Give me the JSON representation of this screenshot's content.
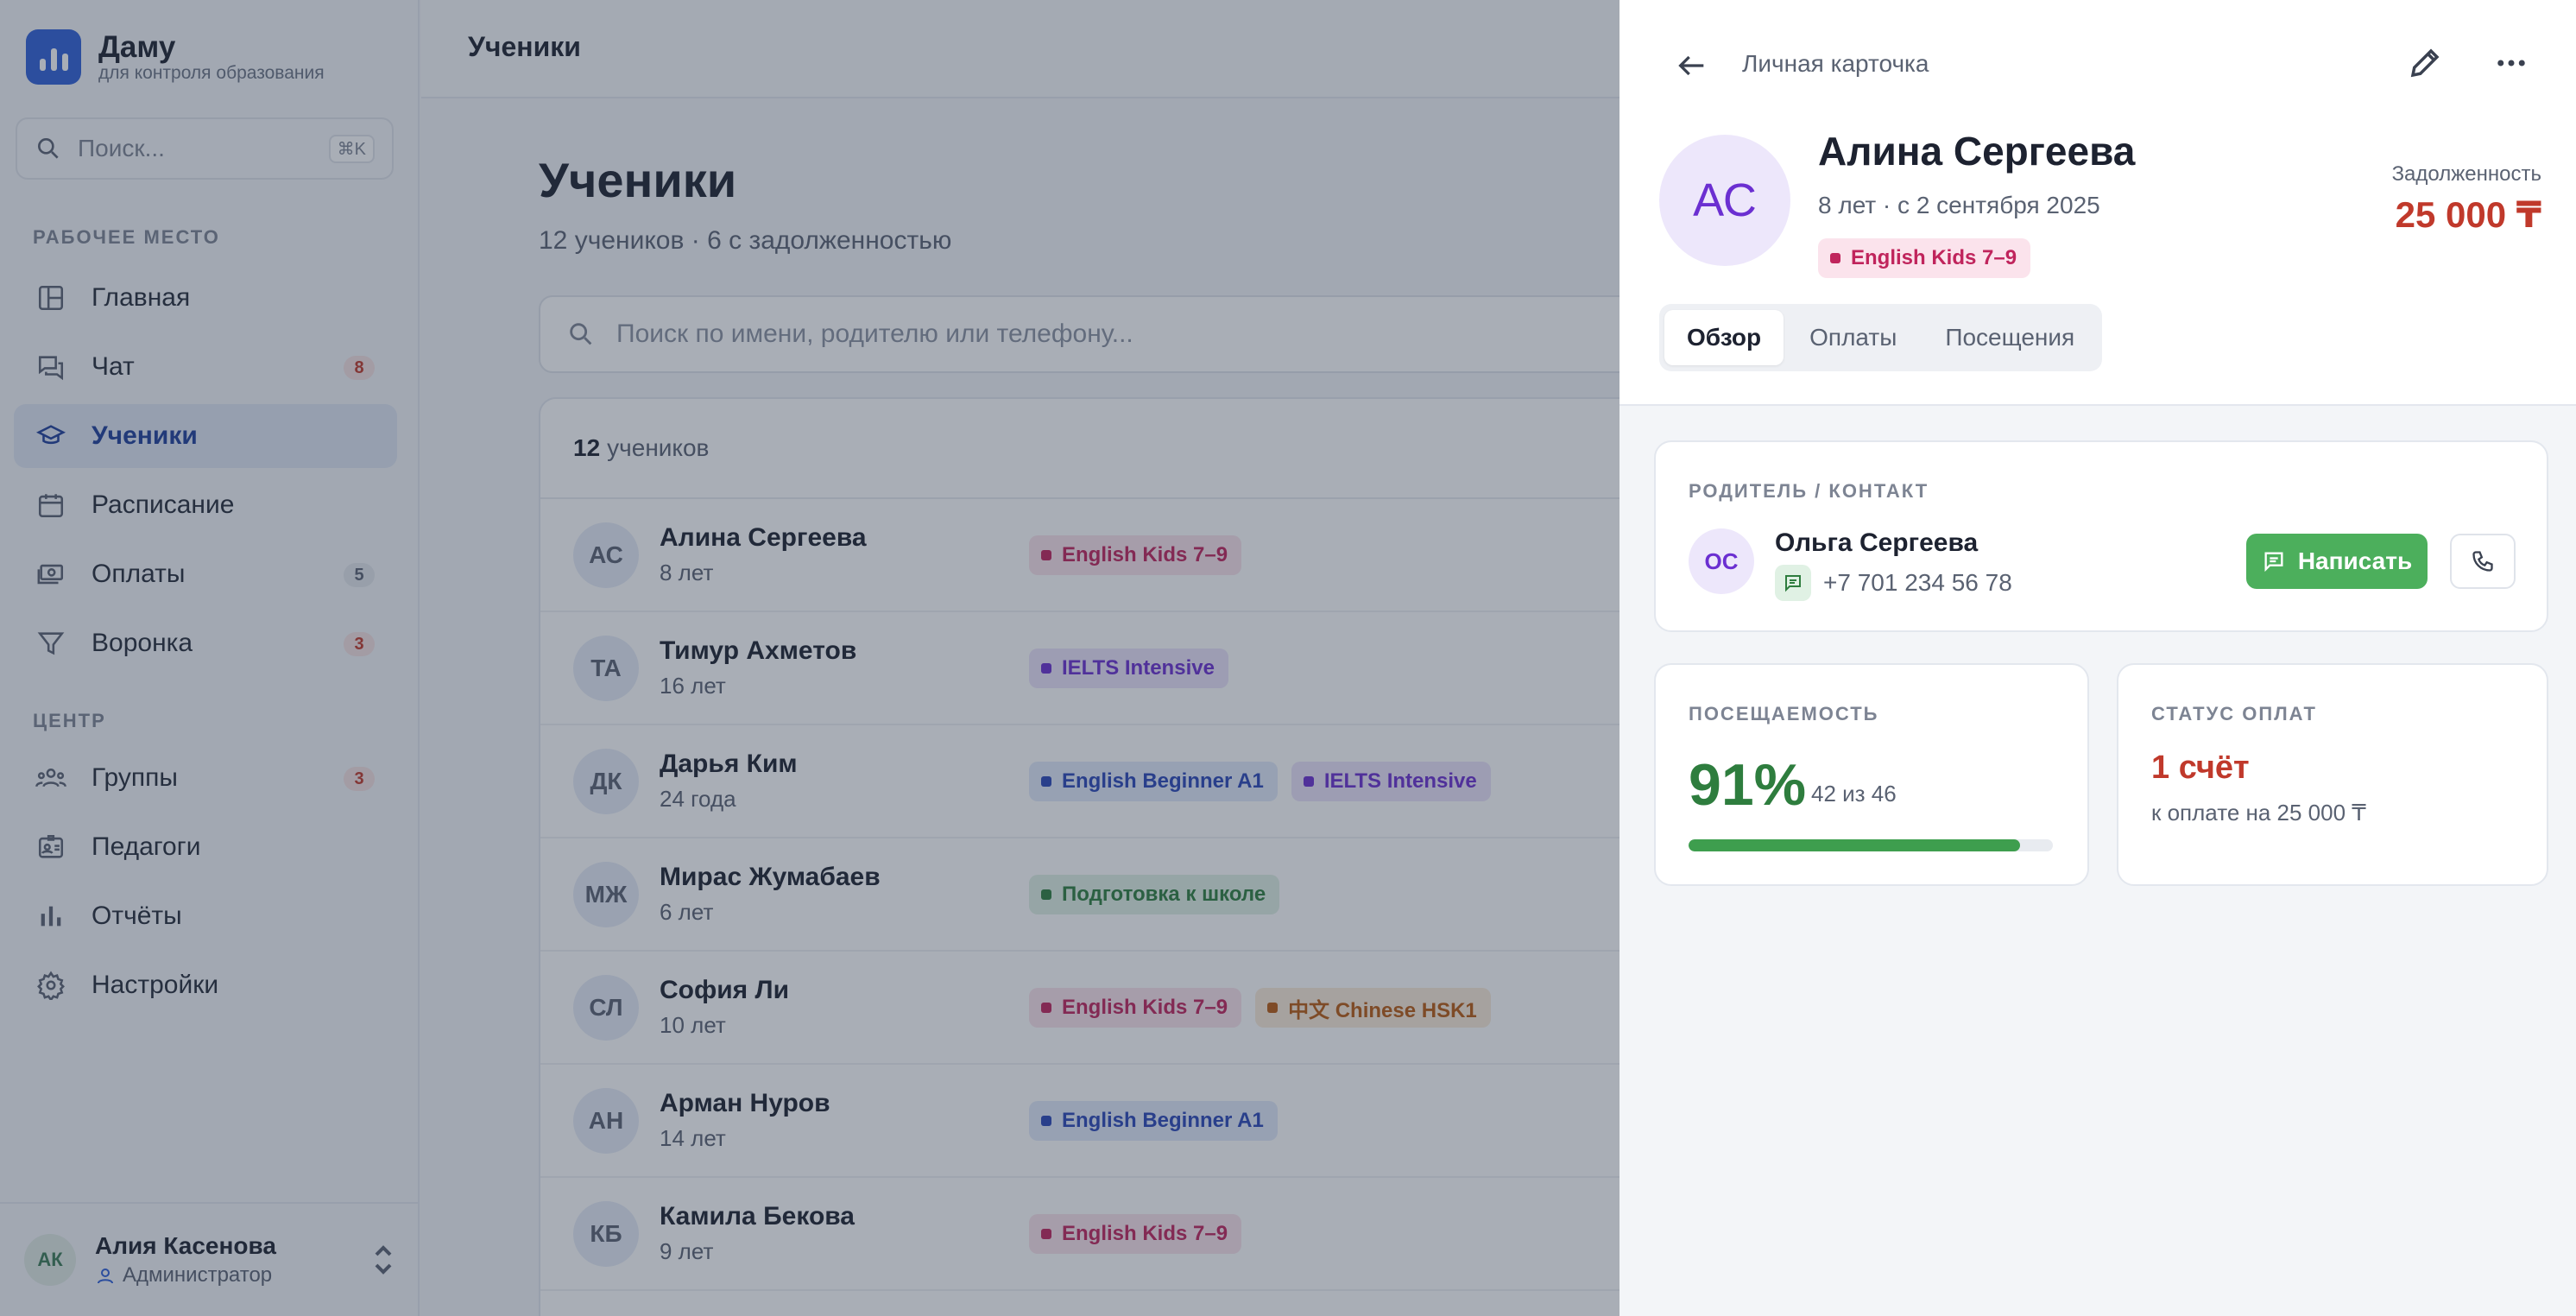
{
  "brand": {
    "name": "Даму",
    "subtitle": "для контроля образования"
  },
  "sidebar": {
    "search_placeholder": "Поиск...",
    "search_shortcut": "⌘K",
    "section_work": "РАБОЧЕЕ МЕСТО",
    "section_center": "ЦЕНТР",
    "items": [
      {
        "label": "Главная",
        "icon": "dashboard-icon"
      },
      {
        "label": "Чат",
        "icon": "chat-icon",
        "badge": "8"
      },
      {
        "label": "Ученики",
        "icon": "graduation-cap-icon",
        "active": true
      },
      {
        "label": "Расписание",
        "icon": "calendar-icon"
      },
      {
        "label": "Оплаты",
        "icon": "money-icon",
        "badge": "5"
      },
      {
        "label": "Воронка",
        "icon": "funnel-icon",
        "badge": "3"
      }
    ],
    "center_items": [
      {
        "label": "Группы",
        "icon": "users-icon",
        "badge": "3"
      },
      {
        "label": "Педагоги",
        "icon": "id-card-icon"
      },
      {
        "label": "Отчёты",
        "icon": "bar-chart-icon"
      },
      {
        "label": "Настройки",
        "icon": "gear-icon"
      }
    ],
    "user": {
      "initials": "АК",
      "name": "Алия Касенова",
      "role": "Администратор"
    }
  },
  "main": {
    "topbar_title": "Ученики",
    "title": "Ученики",
    "subtitle": "12 учеников · 6 с задолженностью",
    "search_placeholder": "Поиск по имени, родителю или телефону...",
    "list_count": "12",
    "list_count_label": "учеников",
    "rows": [
      {
        "initials": "АС",
        "name": "Алина Сергеева",
        "age": "8 лет",
        "tags": [
          {
            "label": "English Kids 7–9",
            "color": "pink"
          }
        ]
      },
      {
        "initials": "ТА",
        "name": "Тимур Ахметов",
        "age": "16 лет",
        "tags": [
          {
            "label": "IELTS Intensive",
            "color": "purple"
          }
        ]
      },
      {
        "initials": "ДК",
        "name": "Дарья Ким",
        "age": "24 года",
        "tags": [
          {
            "label": "English Beginner A1",
            "color": "blue"
          },
          {
            "label": "IELTS Intensive",
            "color": "purple"
          }
        ]
      },
      {
        "initials": "МЖ",
        "name": "Мирас Жумабаев",
        "age": "6 лет",
        "tags": [
          {
            "label": "Подготовка к школе",
            "color": "green"
          }
        ]
      },
      {
        "initials": "СЛ",
        "name": "София Ли",
        "age": "10 лет",
        "tags": [
          {
            "label": "English Kids 7–9",
            "color": "pink"
          },
          {
            "label": "中文 Chinese HSK1",
            "color": "orange"
          }
        ]
      },
      {
        "initials": "АН",
        "name": "Арман Нуров",
        "age": "14 лет",
        "tags": [
          {
            "label": "English Beginner A1",
            "color": "blue"
          }
        ]
      },
      {
        "initials": "КБ",
        "name": "Камила Бекова",
        "age": "9 лет",
        "tags": [
          {
            "label": "English Kids 7–9",
            "color": "pink"
          }
        ]
      }
    ]
  },
  "drawer": {
    "caption": "Личная карточка",
    "initials": "АС",
    "name": "Алина Сергеева",
    "meta": "8 лет · с 2 сентября 2025",
    "tag": "English Kids 7–9",
    "debt_label": "Задолженность",
    "debt_value": "25 000 ₸",
    "tabs": [
      "Обзор",
      "Оплаты",
      "Посещения"
    ],
    "contact": {
      "label": "РОДИТЕЛЬ / КОНТАКТ",
      "initials": "ОС",
      "name": "Ольга Сергеева",
      "phone": "+7 701 234 56 78",
      "write_label": "Написать"
    },
    "attendance": {
      "label": "ПОСЕЩАЕМОСТЬ",
      "percent": "91%",
      "detail": "42 из 46",
      "fraction": 0.91
    },
    "payments": {
      "label": "СТАТУС ОПЛАТ",
      "value": "1 счёт",
      "detail": "к оплате на 25 000 ₸"
    }
  },
  "colors": {
    "accent": "#2f5fd8",
    "debt": "#c0392b",
    "success": "#4caf5c",
    "attendance": "#2e7d3e"
  }
}
